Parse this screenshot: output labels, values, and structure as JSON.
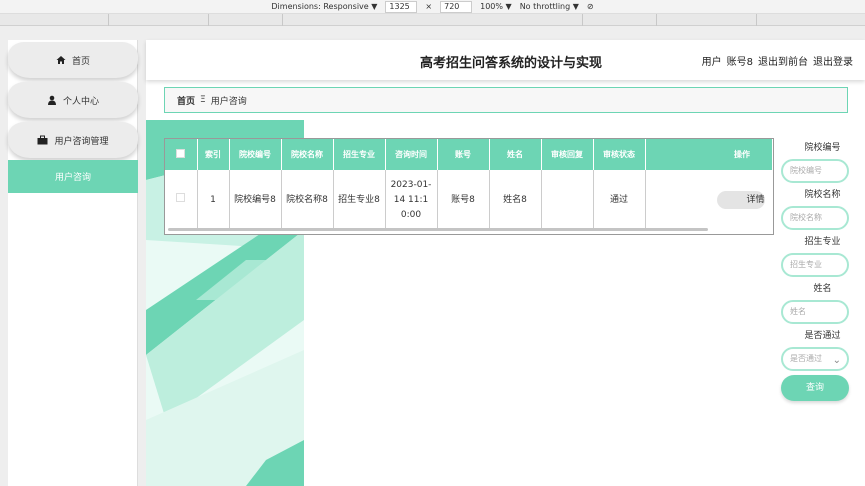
{
  "devtools": {
    "dimensions": "Dimensions: Responsive",
    "width": "1325",
    "times": "×",
    "height": "720",
    "zoom": "100%",
    "throttle": "No throttling",
    "caret": "▼"
  },
  "sidebar": {
    "items": [
      {
        "label": "首页",
        "icon": "home-icon"
      },
      {
        "label": "个人中心",
        "icon": "user-icon"
      },
      {
        "label": "用户咨询管理",
        "icon": "briefcase-icon"
      },
      {
        "label": "用户咨询",
        "icon": ""
      }
    ]
  },
  "header": {
    "title": "高考招生问答系统的设计与实现",
    "user_prefix": "用户",
    "account": "账号8",
    "back_front": "退出到前台",
    "logout": "退出登录"
  },
  "breadcrumb": {
    "home": "首页",
    "separator": "Ξ",
    "current": "用户咨询"
  },
  "table": {
    "headers": [
      "",
      "索引",
      "院校编号",
      "院校名称",
      "招生专业",
      "咨询时间",
      "账号",
      "姓名",
      "审核回复",
      "审核状态",
      "操作"
    ],
    "row": {
      "index": "1",
      "school_id": "院校编号8",
      "school_name": "院校名称8",
      "major": "招生专业8",
      "time": "2023-01-14 11:10:00",
      "account": "账号8",
      "name": "姓名8",
      "reply": "",
      "status": "通过",
      "action": "详情"
    }
  },
  "search": {
    "school_id_label": "院校编号",
    "school_id_placeholder": "院校编号",
    "school_name_label": "院校名称",
    "school_name_placeholder": "院校名称",
    "major_label": "招生专业",
    "major_placeholder": "招生专业",
    "name_label": "姓名",
    "name_placeholder": "姓名",
    "passed_label": "是否通过",
    "passed_placeholder": "是否通过",
    "button": "查询"
  },
  "colors": {
    "accent": "#6dd5b4",
    "accent_light": "#a8e8d3"
  }
}
